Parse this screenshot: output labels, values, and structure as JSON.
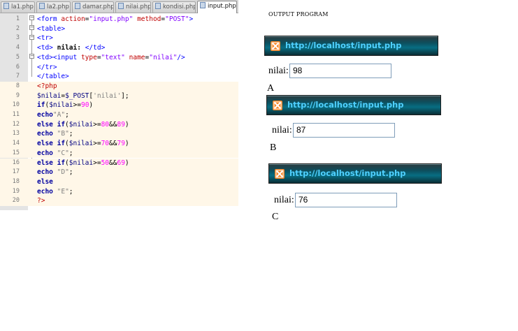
{
  "editor": {
    "tabs": [
      {
        "label": "la1.php"
      },
      {
        "label": "la2.php"
      },
      {
        "label": "damar.php"
      },
      {
        "label": "nilai.php"
      },
      {
        "label": "kondisi.php"
      },
      {
        "label": "input.php"
      }
    ],
    "line_numbers": [
      "1",
      "2",
      "3",
      "4",
      "5",
      "6",
      "7",
      "8",
      "9",
      "10",
      "11",
      "12",
      "13",
      "14",
      "15",
      "16",
      "17",
      "18",
      "19",
      "20"
    ]
  },
  "output": {
    "title": "OUTPUT PROGRAM",
    "label": "nilai:",
    "panels": [
      {
        "url": "http://localhost/input.php",
        "value": "98",
        "letter": "A"
      },
      {
        "url": "http://localhost/input.php",
        "value": "87",
        "letter": "B"
      },
      {
        "url": "http://localhost/input.php",
        "value": "76",
        "letter": "C"
      }
    ]
  }
}
